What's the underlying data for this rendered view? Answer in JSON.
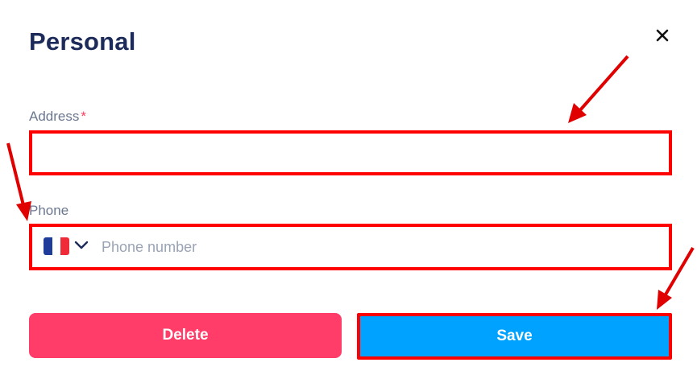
{
  "dialog": {
    "title": "Personal",
    "close_icon": "close-icon"
  },
  "address": {
    "label": "Address",
    "required_mark": "*",
    "value": "",
    "placeholder": ""
  },
  "phone": {
    "label": "Phone",
    "country_flag": "flag-france-icon",
    "dropdown_icon": "chevron-down-icon",
    "value": "",
    "placeholder": "Phone number"
  },
  "actions": {
    "delete_label": "Delete",
    "save_label": "Save"
  },
  "colors": {
    "title": "#1d2b5a",
    "delete": "#ff3d68",
    "save": "#00a2ff",
    "highlight": "#ff0000",
    "required": "#ff3b5c"
  }
}
